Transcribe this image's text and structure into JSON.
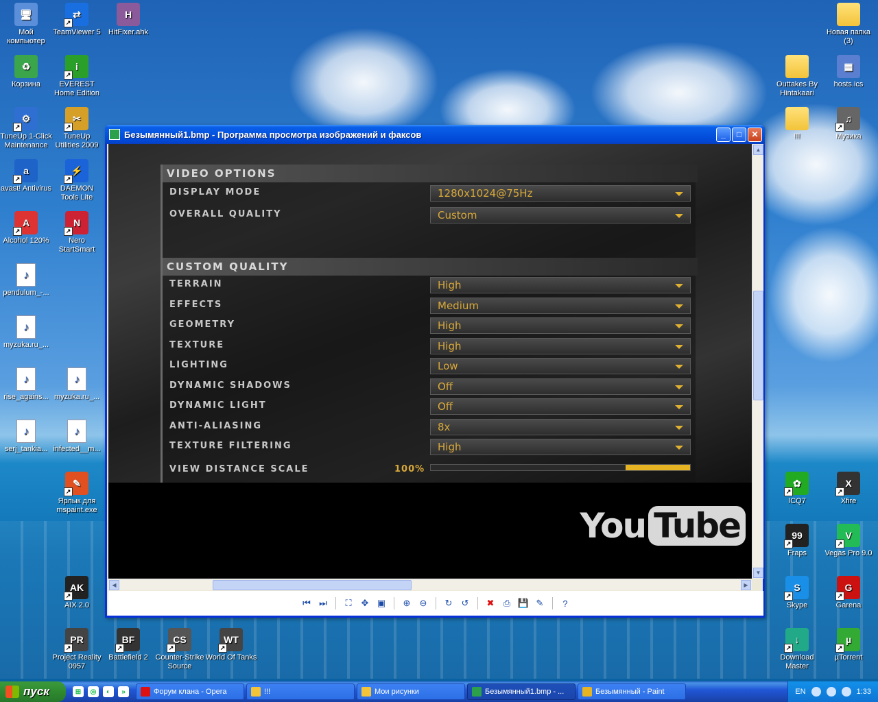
{
  "desktop": {
    "icons": [
      {
        "label": "Мой компьютер",
        "glyph": "🖥",
        "kind": "generic",
        "arrow": false
      },
      {
        "label": "TeamViewer 5",
        "glyph": "⇄",
        "kind": "generic",
        "arrow": true
      },
      {
        "label": "HitFixer.ahk",
        "glyph": "H",
        "kind": "generic",
        "arrow": false
      },
      {
        "label": "Корзина",
        "glyph": "♻",
        "kind": "generic",
        "arrow": false
      },
      {
        "label": "EVEREST Home Edition",
        "glyph": "i",
        "kind": "generic",
        "arrow": true
      },
      {
        "label": "TuneUp 1-Click Maintenance",
        "glyph": "⚙",
        "kind": "generic",
        "arrow": true
      },
      {
        "label": "TuneUp Utilities 2009",
        "glyph": "✂",
        "kind": "generic",
        "arrow": true
      },
      {
        "label": "avast! Antivirus",
        "glyph": "a",
        "kind": "generic",
        "arrow": true
      },
      {
        "label": "DAEMON Tools Lite",
        "glyph": "⚡",
        "kind": "generic",
        "arrow": true
      },
      {
        "label": "Alcohol 120%",
        "glyph": "A",
        "kind": "generic",
        "arrow": true
      },
      {
        "label": "Nero StartSmart",
        "glyph": "N",
        "kind": "generic",
        "arrow": true
      },
      {
        "label": "pendulum_-...",
        "glyph": "♪",
        "kind": "mp3",
        "arrow": false
      },
      {
        "label": "myzuka.ru_...",
        "glyph": "♪",
        "kind": "mp3",
        "arrow": false
      },
      {
        "label": "rise_agains...",
        "glyph": "♪",
        "kind": "mp3",
        "arrow": false
      },
      {
        "label": "myzuka.ru_...",
        "glyph": "♪",
        "kind": "mp3",
        "arrow": false
      },
      {
        "label": "serj_tankia...",
        "glyph": "♪",
        "kind": "mp3",
        "arrow": false
      },
      {
        "label": "infected__m...",
        "glyph": "♪",
        "kind": "mp3",
        "arrow": false
      },
      {
        "label": "Ярлык для mspaint.exe",
        "glyph": "✎",
        "kind": "generic",
        "arrow": true
      },
      {
        "label": "AIX 2.0",
        "glyph": "AK",
        "kind": "generic",
        "arrow": true
      },
      {
        "label": "Project Reality 0957",
        "glyph": "PR",
        "kind": "generic",
        "arrow": true
      },
      {
        "label": "Battlefield 2",
        "glyph": "BF",
        "kind": "generic",
        "arrow": true
      },
      {
        "label": "Counter-Strike Source",
        "glyph": "CS",
        "kind": "generic",
        "arrow": true
      },
      {
        "label": "World Of Tanks",
        "glyph": "WT",
        "kind": "generic",
        "arrow": true
      },
      {
        "label": "Новая папка (3)",
        "glyph": "",
        "kind": "folder",
        "arrow": false
      },
      {
        "label": "Outtakes By Hintakaari",
        "glyph": "",
        "kind": "folder",
        "arrow": false
      },
      {
        "label": "hosts.ics",
        "glyph": "▦",
        "kind": "generic",
        "arrow": false
      },
      {
        "label": "!!!",
        "glyph": "",
        "kind": "folder",
        "arrow": false
      },
      {
        "label": "Музика",
        "glyph": "♫",
        "kind": "generic",
        "arrow": true
      },
      {
        "label": "ICQ7",
        "glyph": "✿",
        "kind": "generic",
        "arrow": true
      },
      {
        "label": "Xfire",
        "glyph": "X",
        "kind": "generic",
        "arrow": true
      },
      {
        "label": "Fraps",
        "glyph": "99",
        "kind": "generic",
        "arrow": true
      },
      {
        "label": "Vegas Pro 9.0",
        "glyph": "V",
        "kind": "generic",
        "arrow": true
      },
      {
        "label": "Skype",
        "glyph": "S",
        "kind": "generic",
        "arrow": true
      },
      {
        "label": "Garena",
        "glyph": "G",
        "kind": "generic",
        "arrow": true
      },
      {
        "label": "Download Master",
        "glyph": "↓",
        "kind": "generic",
        "arrow": true
      },
      {
        "label": "µTorrent",
        "glyph": "µ",
        "kind": "generic",
        "arrow": true
      }
    ]
  },
  "window": {
    "title": "Безымянный1.bmp - Программа просмотра изображений и факсов",
    "buttons": {
      "minimize": "_",
      "maximize": "□",
      "close": "✕"
    }
  },
  "game": {
    "video_options_header": "VIDEO OPTIONS",
    "custom_quality_header": "CUSTOM QUALITY",
    "video_options": [
      {
        "label": "DISPLAY MODE",
        "value": "1280x1024@75Hz"
      },
      {
        "label": "OVERALL QUALITY",
        "value": "Custom"
      }
    ],
    "custom_quality": [
      {
        "label": "TERRAIN",
        "value": "High"
      },
      {
        "label": "EFFECTS",
        "value": "Medium"
      },
      {
        "label": "GEOMETRY",
        "value": "High"
      },
      {
        "label": "TEXTURE",
        "value": "High"
      },
      {
        "label": "LIGHTING",
        "value": "Low"
      },
      {
        "label": "DYNAMIC SHADOWS",
        "value": "Off"
      },
      {
        "label": "DYNAMIC LIGHT",
        "value": "Off"
      },
      {
        "label": "ANTI-ALIASING",
        "value": "8x"
      },
      {
        "label": "TEXTURE FILTERING",
        "value": "High"
      }
    ],
    "view_distance": {
      "label": "VIEW DISTANCE SCALE",
      "value": "100%",
      "fraction": 1.0
    },
    "watermark": {
      "you": "You",
      "tube": "Tube"
    }
  },
  "taskbar": {
    "start_label": "пуск",
    "quick_launch": [
      "⊞",
      "◎",
      "◐",
      "»"
    ],
    "tasks": [
      {
        "label": "Форум клана - Opera",
        "color": "#d11",
        "active": false
      },
      {
        "label": "!!!",
        "color": "#f3c33a",
        "active": false
      },
      {
        "label": "Мои рисунки",
        "color": "#f3c33a",
        "active": false
      },
      {
        "label": "Безымянный1.bmp - ...",
        "color": "#2ca04b",
        "active": true
      },
      {
        "label": "Безымянный - Paint",
        "color": "#e6b422",
        "active": false
      }
    ],
    "lang": "EN",
    "clock": "1:33"
  }
}
